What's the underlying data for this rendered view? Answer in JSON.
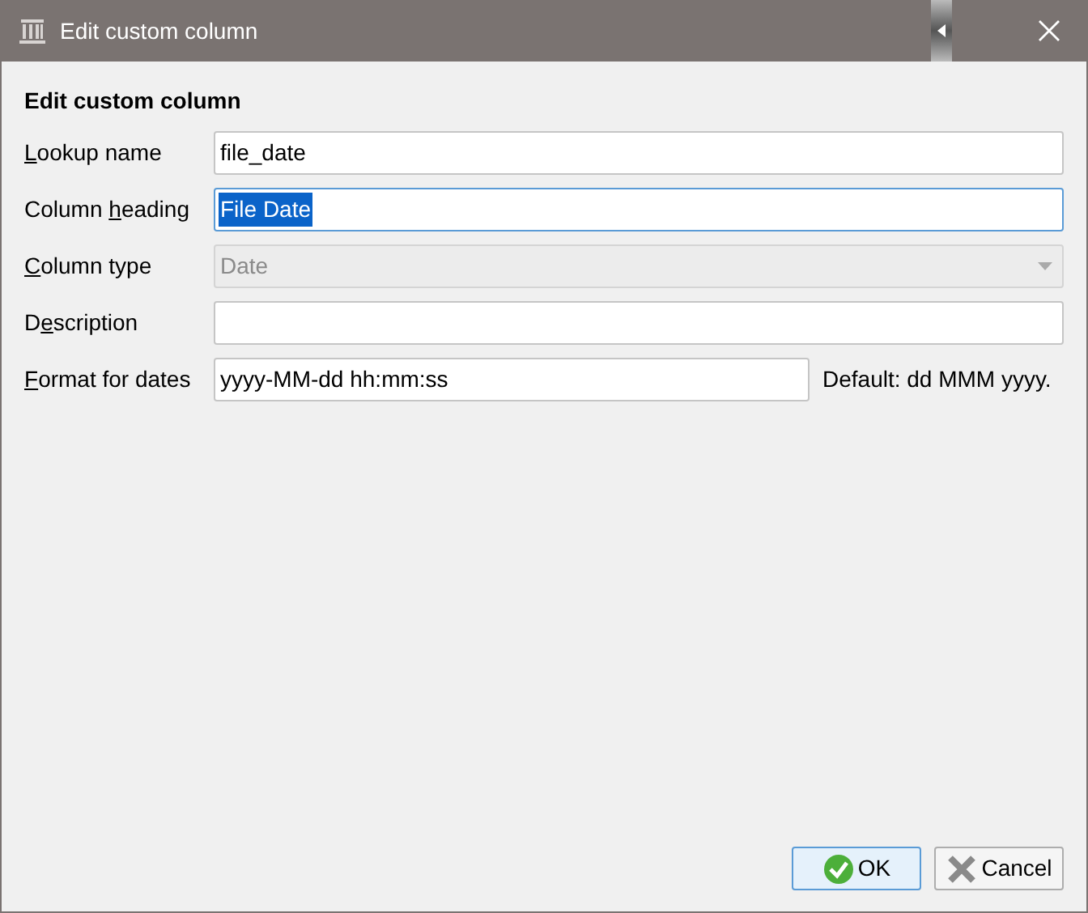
{
  "window": {
    "title": "Edit custom column"
  },
  "heading": "Edit custom column",
  "rows": [
    {
      "kind": "text",
      "label_before": "",
      "label_key": "L",
      "label_after": "ookup name",
      "value": "file_date",
      "focused": false,
      "text_selected": false
    },
    {
      "kind": "text",
      "label_before": "Column ",
      "label_key": "h",
      "label_after": "eading",
      "value": "File Date",
      "focused": true,
      "text_selected": true
    },
    {
      "kind": "combo",
      "label_before": "",
      "label_key": "C",
      "label_after": "olumn type",
      "value": "Date",
      "disabled": true
    },
    {
      "kind": "text",
      "label_before": "D",
      "label_key": "e",
      "label_after": "scription",
      "value": "",
      "focused": false
    },
    {
      "kind": "text_hint",
      "label_before": "",
      "label_key": "F",
      "label_after": "ormat for dates",
      "value": "yyyy-MM-dd hh:mm:ss",
      "hint": "Default: dd MMM yyyy.",
      "focused": false,
      "text_selected": false
    }
  ],
  "buttons": [
    {
      "label": "OK",
      "kind": "ok",
      "default": true
    },
    {
      "label": "Cancel",
      "kind": "cancel",
      "default": false
    }
  ]
}
